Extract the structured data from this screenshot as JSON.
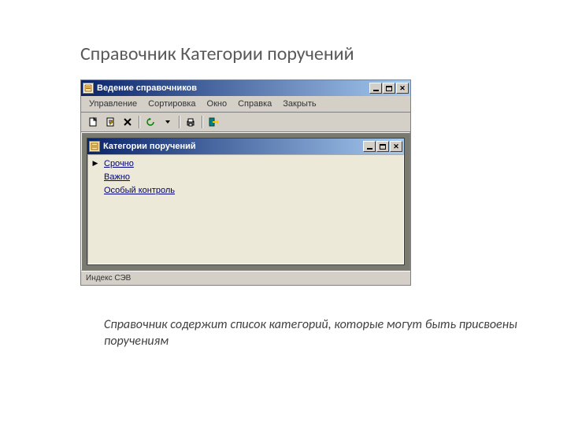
{
  "page_title": "Справочник Категории поручений",
  "outer_window": {
    "title": "Ведение справочников",
    "menu": [
      "Управление",
      "Сортировка",
      "Окно",
      "Справка",
      "Закрыть"
    ],
    "status": "Индекс СЭВ"
  },
  "toolbar_icons": {
    "new": "new-file-icon",
    "edit": "edit-icon",
    "delete": "delete-icon",
    "refresh": "refresh-icon",
    "print": "print-icon",
    "exit": "exit-icon"
  },
  "inner_window": {
    "title": "Категории поручений",
    "items": [
      "Срочно",
      "Важно",
      "Особый контроль"
    ],
    "selected_index": 0
  },
  "description": "Справочник содержит список категорий, которые могут быть присвоены поручениям"
}
